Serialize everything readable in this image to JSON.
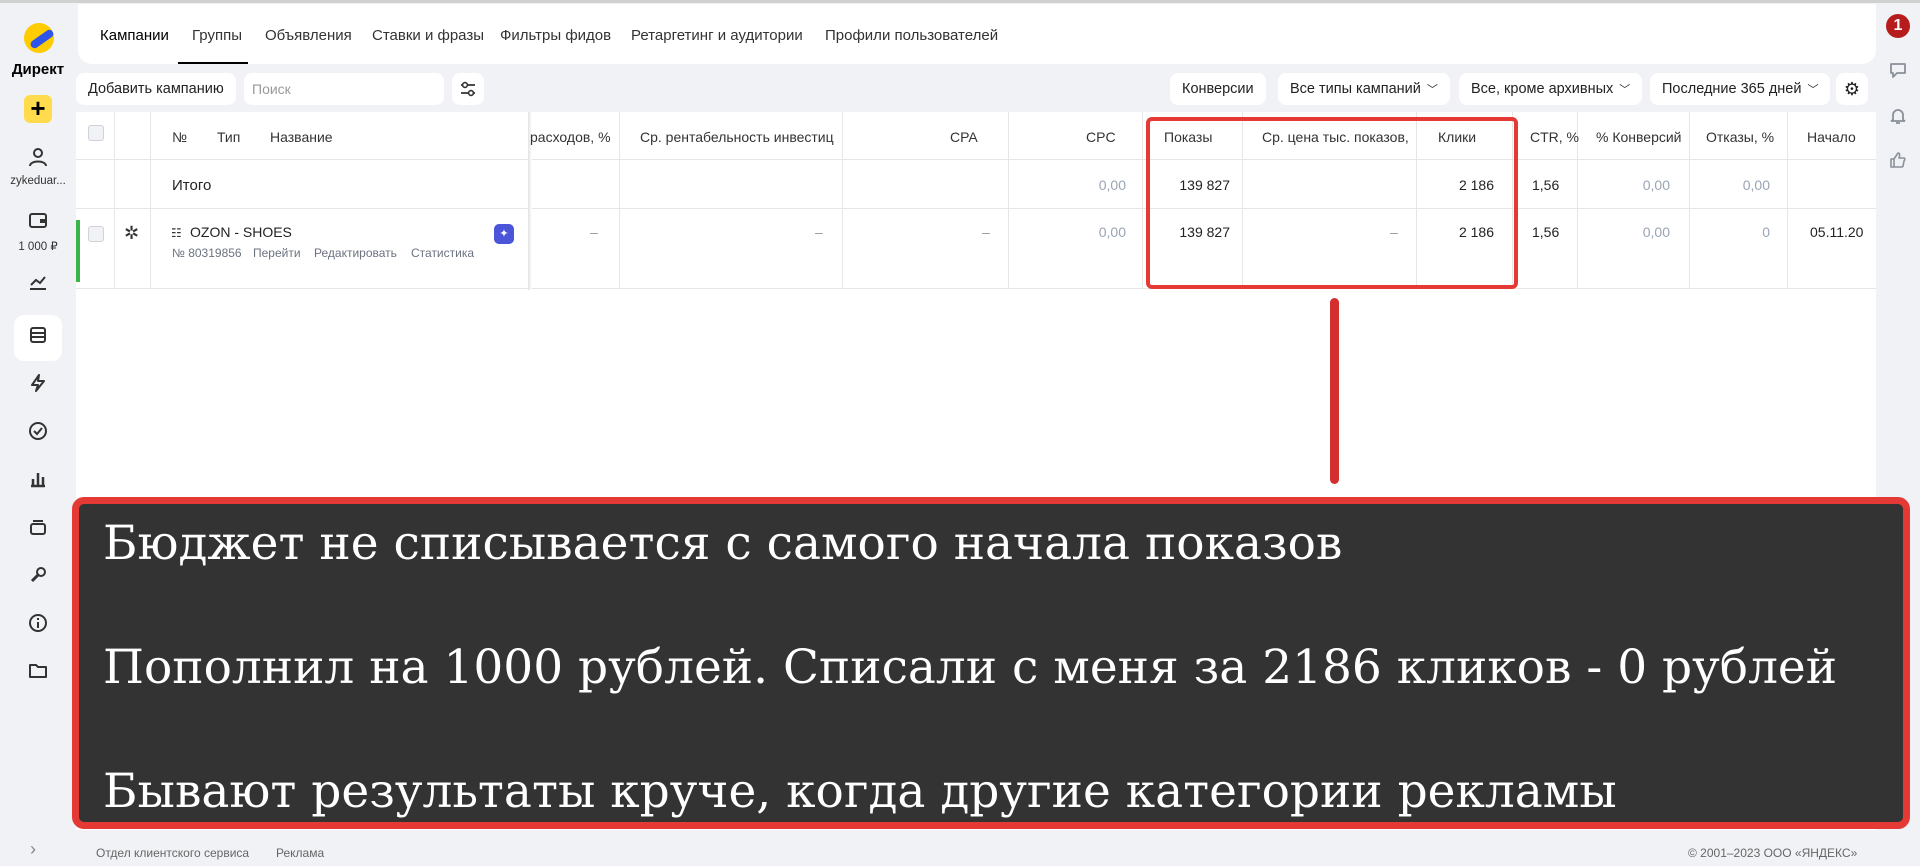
{
  "sidebar": {
    "logo_text": "Директ",
    "add_label": "+",
    "user": "zykeduar...",
    "balance": "1 000 ₽"
  },
  "tabs": [
    {
      "label": "Кампании"
    },
    {
      "label": "Группы"
    },
    {
      "label": "Объявления"
    },
    {
      "label": "Ставки и фразы"
    },
    {
      "label": "Фильтры фидов"
    },
    {
      "label": "Ретаргетинг и аудитории"
    },
    {
      "label": "Профили пользователей"
    }
  ],
  "toolbar": {
    "add_campaign": "Добавить кампанию",
    "search_placeholder": "Поиск",
    "conversions": "Конверсии",
    "campaign_types": "Все типы кампаний",
    "archive_filter": "Все, кроме архивных",
    "period": "Последние 365 дней"
  },
  "table": {
    "headers": {
      "num": "№",
      "type": "Тип",
      "name": "Название",
      "cost_share": "расходов, %",
      "roi": "Ср. рентабельность инвестиц",
      "cpa": "CPA",
      "cpc": "CPC",
      "impressions": "Показы",
      "cpm": "Ср. цена тыс. показов,",
      "clicks": "Клики",
      "ctr": "CTR, %",
      "conv": "% Конверсий",
      "bounce": "Отказы, %",
      "start": "Начало"
    },
    "total": {
      "label": "Итого",
      "cpc": "0,00",
      "impressions": "139 827",
      "clicks": "2 186",
      "ctr": "1,56",
      "conv": "0,00",
      "bounce": "0,00"
    },
    "campaign": {
      "name": "OZON - SHOES",
      "id": "№ 80319856",
      "link_go": "Перейти",
      "link_edit": "Редактировать",
      "link_stats": "Статистика",
      "cost_share": "–",
      "roi": "–",
      "cpa": "–",
      "cpc": "0,00",
      "impressions": "139 827",
      "cpm": "–",
      "clicks": "2 186",
      "ctr": "1,56",
      "conv": "0,00",
      "bounce": "0",
      "start": "05.11.20"
    }
  },
  "overlay": {
    "line1": "Бюджет не списывается с самого начала показов",
    "line2": "Пополнил на 1000 рублей. Списали с меня за 2186 кликов - 0 рублей",
    "line3": "Бывают результаты круче, когда другие категории рекламы"
  },
  "footer": {
    "support": "Отдел клиентского сервиса",
    "ads": "Реклама",
    "copyright": "© 2001–2023 ООО «ЯНДЕКС»"
  },
  "notifications": "1",
  "colors": {
    "accent_yellow": "#ffdb4d",
    "highlight_red": "#e53935",
    "overlay_bg": "#333333",
    "active_green": "#3bb54a"
  }
}
